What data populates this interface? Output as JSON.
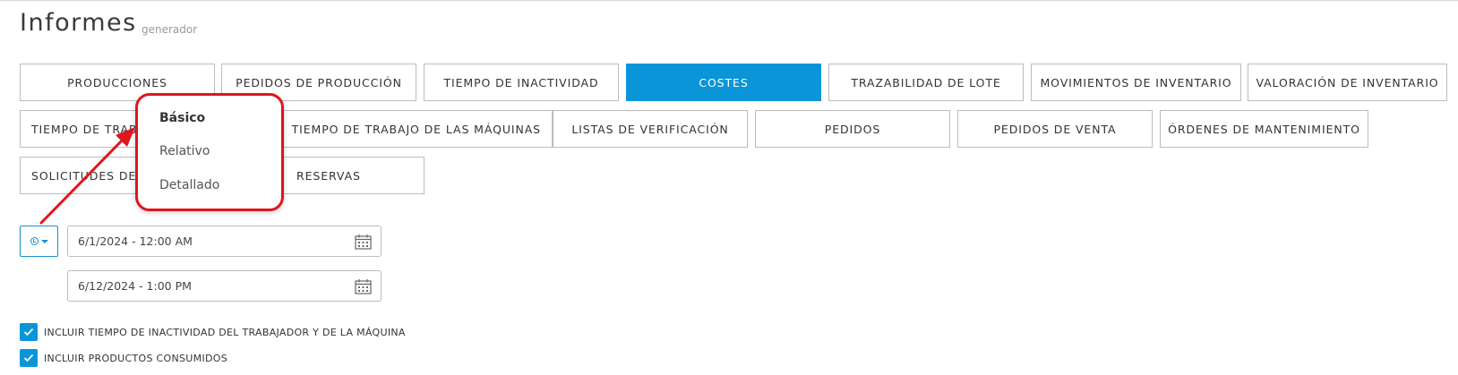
{
  "header": {
    "title": "Informes",
    "subtitle": "generador"
  },
  "tabs": [
    {
      "label": "PRODUCCIONES"
    },
    {
      "label": "PEDIDOS DE PRODUCCIÓN"
    },
    {
      "label": "TIEMPO DE INACTIVIDAD"
    },
    {
      "label": "COSTES",
      "active": true
    },
    {
      "label": "TRAZABILIDAD DE LOTE"
    },
    {
      "label": "MOVIMIENTOS DE INVENTARIO"
    },
    {
      "label": "VALORACIÓN DE INVENTARIO"
    },
    {
      "label": "TIEMPO DE TRAB"
    },
    {
      "label": "TIEMPO DE TRABAJO DE LAS MÁQUINAS"
    },
    {
      "label": "LISTAS DE VERIFICACIÓN"
    },
    {
      "label": "PEDIDOS"
    },
    {
      "label": "PEDIDOS DE VENTA"
    },
    {
      "label": "ÓRDENES DE MANTENIMIENTO"
    },
    {
      "label": "SOLICITUDES DE"
    },
    {
      "label": "RESERVAS"
    }
  ],
  "dropdown": {
    "items": [
      "Básico",
      "Relativo",
      "Detallado"
    ],
    "selected": "Básico"
  },
  "date_range": {
    "start": "6/1/2024 - 12:00 AM",
    "end": "6/12/2024 - 1:00 PM"
  },
  "options": [
    {
      "label": "INCLUIR TIEMPO DE INACTIVIDAD DEL TRABAJADOR Y DE LA MÁQUINA",
      "checked": true
    },
    {
      "label": "INCLUIR PRODUCTOS CONSUMIDOS",
      "checked": true
    }
  ],
  "colors": {
    "accent": "#0a95d8",
    "annotation": "#e0151d"
  }
}
